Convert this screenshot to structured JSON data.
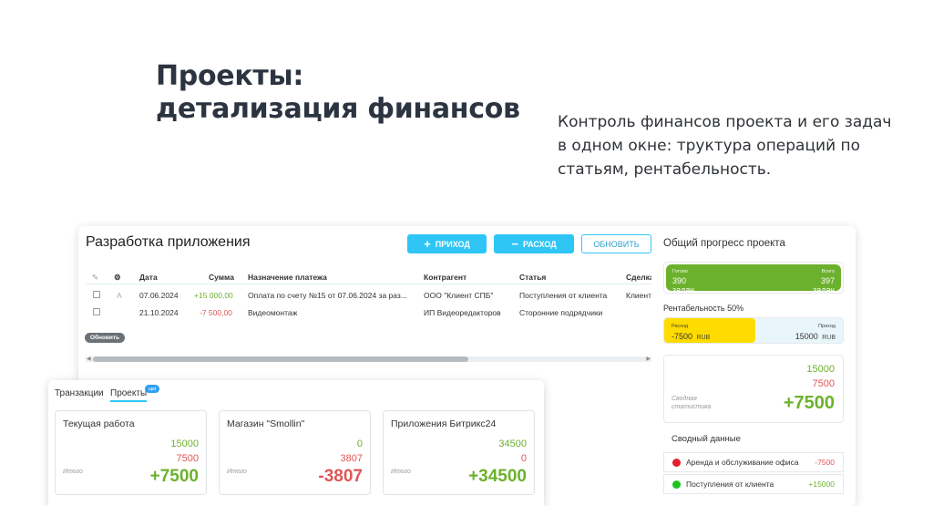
{
  "hero": {
    "title_line1": "Проекты:",
    "title_line2": "детализация финансов",
    "subtitle_line1": "Контроль финансов проекта и его задач",
    "subtitle_line2": "в одном окне: труктура операций по",
    "subtitle_line3": "статьям, рентабельность."
  },
  "main": {
    "title": "Разработка приложения",
    "buttons": {
      "income": "ПРИХОД",
      "expense": "РАСХОД",
      "refresh": "ОБНОВИТЬ"
    },
    "table": {
      "headers": {
        "edit": "✎",
        "settings": "⚙",
        "date": "Дата",
        "amount": "Сумма",
        "purpose": "Назначение платежа",
        "counterparty": "Контрагент",
        "article": "Статья",
        "deal": "Сделка"
      },
      "rows": [
        {
          "flag": "A",
          "date": "07.06.2024",
          "amount": "+15 000,00",
          "purpose": "Оплата по счету №15 от 07.06.2024 за раз...",
          "counterparty": "ООО \"Клиент СПБ\"",
          "article": "Поступления от клиента",
          "deal": "Клиент"
        },
        {
          "flag": "",
          "date": "21.10.2024",
          "amount": "-7 500,00",
          "purpose": "Видеомонтаж",
          "counterparty": "ИП Видеоредакторов",
          "article": "Сторонние подрядчики",
          "deal": ""
        }
      ]
    },
    "refresh_pill": "Обновить"
  },
  "side": {
    "progress_title": "Общий прогресс проекта",
    "progress": {
      "done_label": "Готово",
      "done_value": "390",
      "done_unit": "задач",
      "total_label": "Всего",
      "total_value": "397",
      "total_unit": "задач"
    },
    "profitability_title": "Рентабельность 50%",
    "profitability": {
      "expense_label": "Расход",
      "expense_value": "-7500",
      "expense_currency": "RUB",
      "income_label": "Приход",
      "income_value": "15000",
      "income_currency": "RUB"
    },
    "summary": {
      "income": "15000",
      "expense": "7500",
      "label_line1": "Сводная",
      "label_line2": "статистика",
      "total": "+7500"
    },
    "aggregate_title": "Сводный данные",
    "aggregate": [
      {
        "label": "Аренда и обслуживание офиса",
        "value": "-7500",
        "color": "#e5202e"
      },
      {
        "label": "Поступления от клиента",
        "value": "+15000",
        "color": "#1ec41e"
      }
    ]
  },
  "projects_panel": {
    "tabs": [
      "Транзакции",
      "Проекты"
    ],
    "badge": "upd",
    "total_label": "Итого",
    "cards": [
      {
        "name": "Текущая работа",
        "income": "15000",
        "expense": "7500",
        "total": "+7500",
        "total_color": "#6cb12d"
      },
      {
        "name": "Магазин \"Smollin\"",
        "income": "0",
        "expense": "3807",
        "total": "-3807",
        "total_color": "#e05555"
      },
      {
        "name": "Приложения Битрикс24",
        "income": "34500",
        "expense": "0",
        "total": "+34500",
        "total_color": "#6cb12d"
      }
    ]
  }
}
